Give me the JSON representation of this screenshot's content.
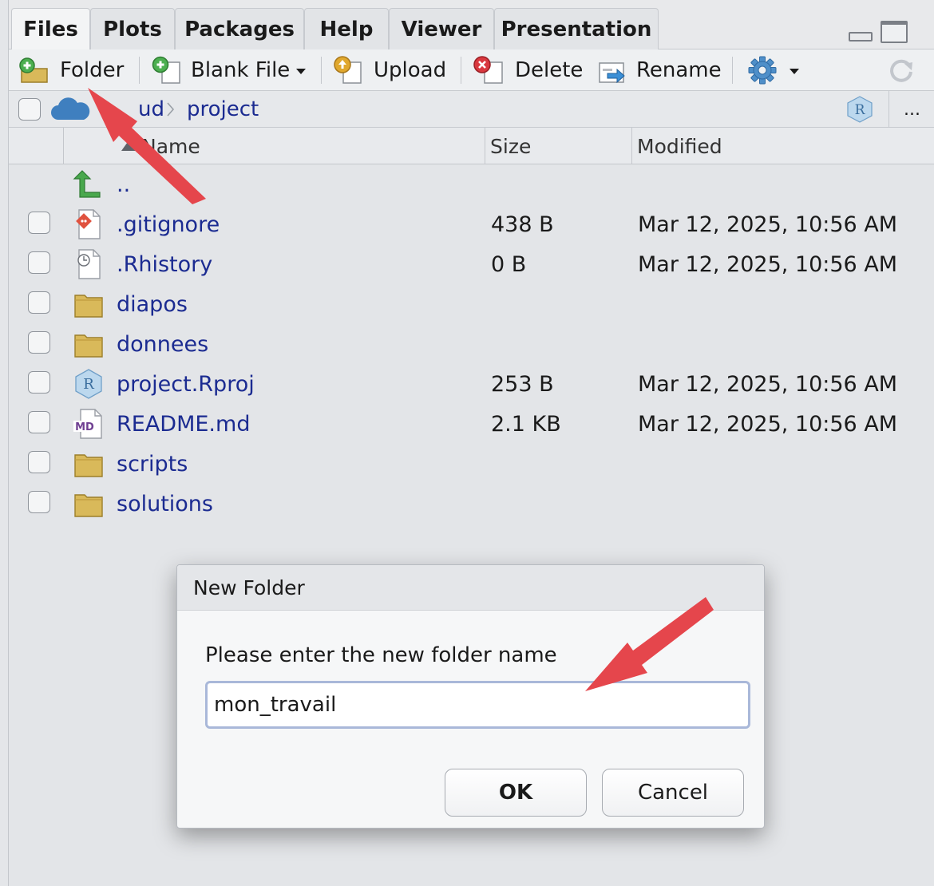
{
  "tabs": [
    {
      "label": "Files",
      "active": true
    },
    {
      "label": "Plots",
      "active": false
    },
    {
      "label": "Packages",
      "active": false
    },
    {
      "label": "Help",
      "active": false
    },
    {
      "label": "Viewer",
      "active": false
    },
    {
      "label": "Presentation",
      "active": false
    }
  ],
  "toolbar": {
    "new_folder": "Folder",
    "blank_file": "Blank File",
    "upload": "Upload",
    "delete": "Delete",
    "rename": "Rename"
  },
  "breadcrumb": {
    "parent": "ud",
    "current": "project",
    "more": "..."
  },
  "table": {
    "columns": {
      "name": "Name",
      "size": "Size",
      "modified": "Modified"
    },
    "parent_link": "..",
    "rows": [
      {
        "name": ".gitignore",
        "size": "438 B",
        "modified": "Mar 12, 2025, 10:56 AM",
        "icon": "git-file-icon"
      },
      {
        "name": ".Rhistory",
        "size": "0 B",
        "modified": "Mar 12, 2025, 10:56 AM",
        "icon": "history-file-icon"
      },
      {
        "name": "diapos",
        "size": "",
        "modified": "",
        "icon": "folder-icon"
      },
      {
        "name": "donnees",
        "size": "",
        "modified": "",
        "icon": "folder-icon"
      },
      {
        "name": "project.Rproj",
        "size": "253 B",
        "modified": "Mar 12, 2025, 10:56 AM",
        "icon": "rproj-file-icon"
      },
      {
        "name": "README.md",
        "size": "2.1 KB",
        "modified": "Mar 12, 2025, 10:56 AM",
        "icon": "markdown-file-icon"
      },
      {
        "name": "scripts",
        "size": "",
        "modified": "",
        "icon": "folder-icon"
      },
      {
        "name": "solutions",
        "size": "",
        "modified": "",
        "icon": "folder-icon"
      }
    ]
  },
  "dialog": {
    "title": "New Folder",
    "prompt": "Please enter the new folder name",
    "input_value": "mon_travail",
    "ok_label": "OK",
    "cancel_label": "Cancel"
  },
  "colors": {
    "link": "#1b2b91",
    "annotation_arrow": "#e5464c",
    "folder": "#d9b95a"
  }
}
